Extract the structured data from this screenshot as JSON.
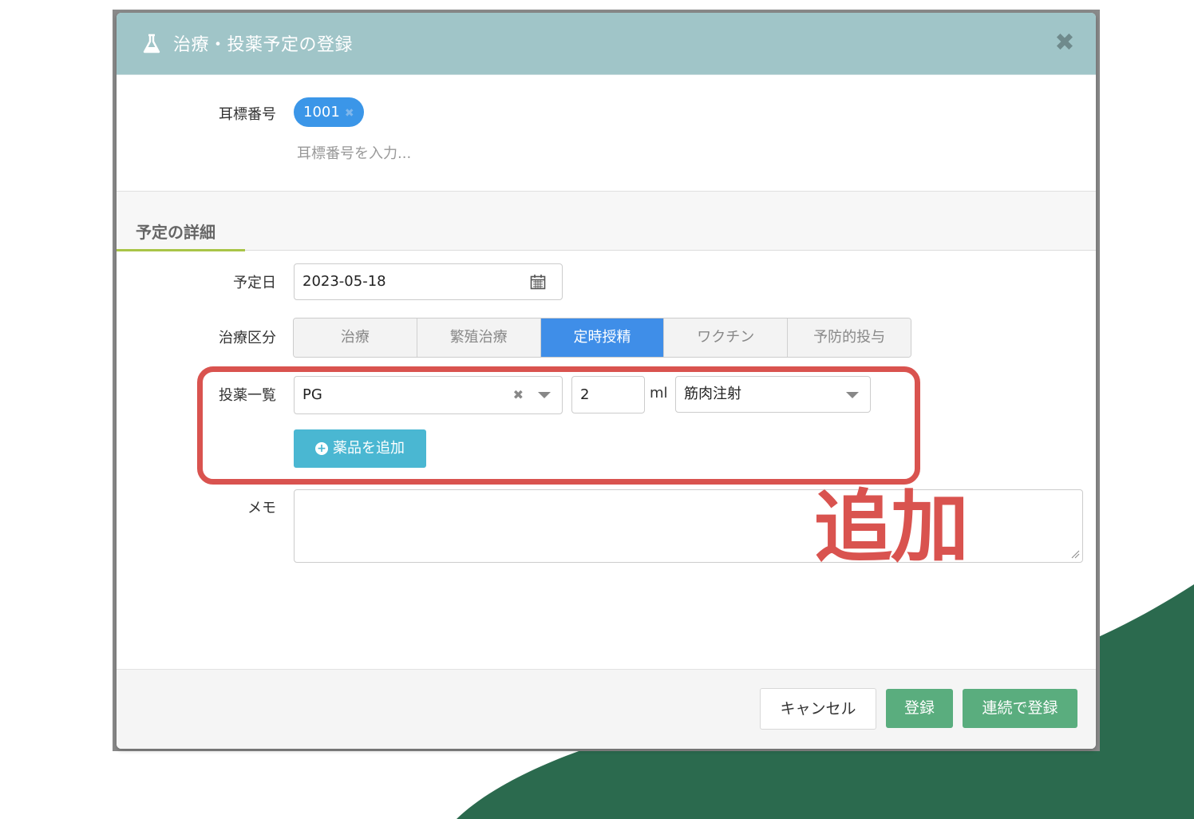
{
  "modal": {
    "title": "治療・投薬予定の登録",
    "header_icon": "flask-icon",
    "close_icon": "close-icon",
    "close_label": "✖"
  },
  "ear_tag": {
    "label": "耳標番号",
    "tags": [
      {
        "value": "1001",
        "remove_label": "✖"
      }
    ],
    "placeholder": "耳標番号を入力..."
  },
  "details": {
    "section_title": "予定の詳細",
    "date_label": "予定日",
    "date_value": "2023-05-18",
    "date_icon": "calendar-icon",
    "category_label": "治療区分",
    "categories": [
      {
        "label": "治療",
        "active": false
      },
      {
        "label": "繁殖治療",
        "active": false
      },
      {
        "label": "定時授精",
        "active": true
      },
      {
        "label": "ワクチン",
        "active": false
      },
      {
        "label": "予防的投与",
        "active": false
      }
    ],
    "drug_list_label": "投薬一覧",
    "drug_name": "PG",
    "drug_clear": "✖",
    "drug_qty": "2",
    "drug_unit": "ml",
    "drug_route": "筋肉注射",
    "add_drug_label": "薬品を追加",
    "memo_label": "メモ",
    "memo_value": ""
  },
  "footer": {
    "cancel_label": "キャンセル",
    "register_label": "登録",
    "register_continuous_label": "連続で登録"
  },
  "annotation": {
    "text": "追加",
    "color": "#d9534f"
  },
  "colors": {
    "header_bg": "#a0c5c8",
    "accent_blue": "#3f8ee8",
    "info_button": "#4ab7d2",
    "success_button": "#5aad7e",
    "decor_green": "#2b6a4e"
  }
}
